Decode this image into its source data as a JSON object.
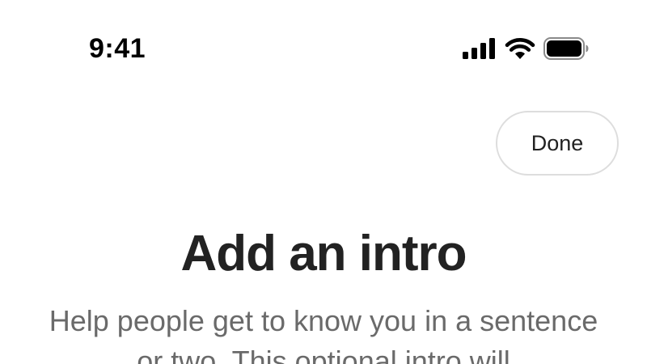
{
  "status_bar": {
    "time": "9:41",
    "icons": [
      "cellular-signal-icon",
      "wifi-icon",
      "battery-icon"
    ]
  },
  "header": {
    "done_label": "Done"
  },
  "main": {
    "title": "Add an intro",
    "description": "Help people get to know you in a sentence or two. This optional intro will"
  },
  "colors": {
    "background": "#ffffff",
    "title_text": "#222222",
    "body_text": "#6a6a6a",
    "button_border": "#dddddd"
  }
}
